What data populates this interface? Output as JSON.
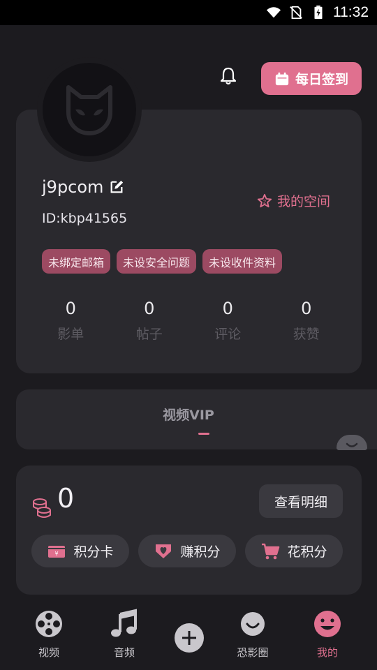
{
  "status_bar": {
    "time": "11:32"
  },
  "header": {
    "checkin_label": "每日签到"
  },
  "profile": {
    "username": "j9pcom",
    "user_id": "ID:kbp41565",
    "my_space_label": "我的空间",
    "tags": [
      "未绑定邮箱",
      "未设安全问题",
      "未设收件资料"
    ],
    "stats": [
      {
        "value": "0",
        "label": "影单"
      },
      {
        "value": "0",
        "label": "帖子"
      },
      {
        "value": "0",
        "label": "评论"
      },
      {
        "value": "0",
        "label": "获赞"
      }
    ]
  },
  "vip": {
    "tab_label": "视频VIP"
  },
  "points": {
    "balance": "0",
    "detail_label": "查看明细",
    "card_label": "积分卡",
    "earn_label": "赚积分",
    "spend_label": "花积分"
  },
  "bottom_nav": {
    "items": [
      {
        "label": "视频"
      },
      {
        "label": "音频"
      },
      {
        "label": "恐影圈"
      },
      {
        "label": "我的"
      }
    ]
  },
  "colors": {
    "accent": "#e0708f",
    "background": "#1c1b1f",
    "card": "#2a292e",
    "tag": "#9c4a62"
  }
}
